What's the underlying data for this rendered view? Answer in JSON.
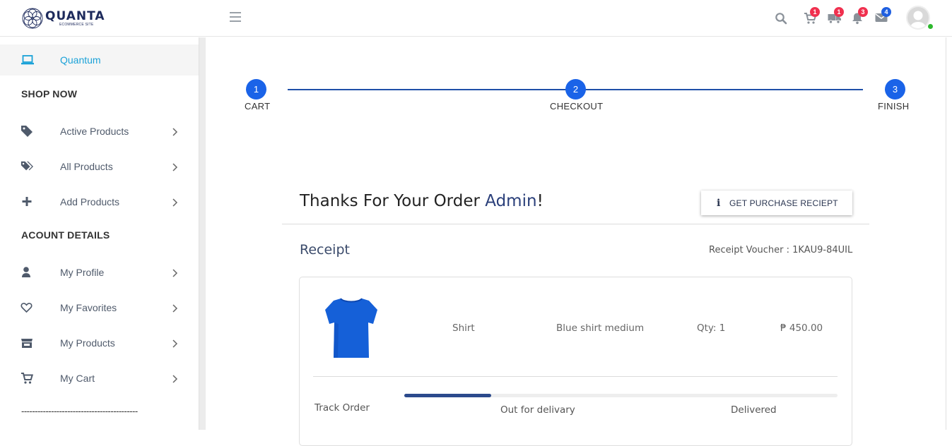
{
  "app": {
    "logo_word": "QUANTA",
    "logo_sub": "ECOMMERCE SITE"
  },
  "header": {
    "icons": [
      {
        "name": "search-icon"
      },
      {
        "name": "cart-icon",
        "badge": "1",
        "badge_color": "#f0304f"
      },
      {
        "name": "truck-icon",
        "badge": "1",
        "badge_color": "#f0304f"
      },
      {
        "name": "bell-icon",
        "badge": "3",
        "badge_color": "#f0304f"
      },
      {
        "name": "mail-icon",
        "badge": "4",
        "badge_color": "#1f5fe0"
      }
    ],
    "status_color": "#2eb82e"
  },
  "sidebar": {
    "active": {
      "label": "Quantum",
      "icon": "laptop-icon",
      "color": "#1ba2d8"
    },
    "sections": [
      {
        "title": "SHOP NOW",
        "items": [
          {
            "label": "Active Products",
            "icon": "tag-icon"
          },
          {
            "label": "All Products",
            "icon": "tags-icon"
          },
          {
            "label": "Add Products",
            "icon": "plus-icon"
          }
        ]
      },
      {
        "title": "ACOUNT DETAILS",
        "items": [
          {
            "label": "My Profile",
            "icon": "user-icon"
          },
          {
            "label": "My Favorites",
            "icon": "heart-icon"
          },
          {
            "label": "My Products",
            "icon": "store-icon"
          },
          {
            "label": "My Cart",
            "icon": "cart-icon"
          }
        ]
      }
    ],
    "separator": "-------------------------------------------"
  },
  "stepper": {
    "steps": [
      {
        "number": "1",
        "label": "CART"
      },
      {
        "number": "2",
        "label": "CHECKOUT"
      },
      {
        "number": "3",
        "label": "FINISH"
      }
    ],
    "color": "#1a63e8"
  },
  "order": {
    "thanks_prefix": "Thanks For Your Order ",
    "thanks_name": "Admin",
    "thanks_suffix": "!",
    "receipt_button": {
      "icon": "i",
      "label": "GET PURCHASE RECIEPT"
    },
    "receipt_title": "Receipt",
    "voucher": "Receipt Voucher : 1KAU9-84UIL",
    "item": {
      "name": "Shirt",
      "description": "Blue shirt medium",
      "qty": "Qty: 1",
      "price": "₱ 450.00",
      "image_icon": "blue-shirt-image",
      "color": "#1560d8"
    },
    "tracking": {
      "label": "Track Order",
      "progress_fraction": 0.2,
      "steps": [
        "Out for delivary",
        "Delivered"
      ],
      "color": "#2c4a8c"
    }
  }
}
